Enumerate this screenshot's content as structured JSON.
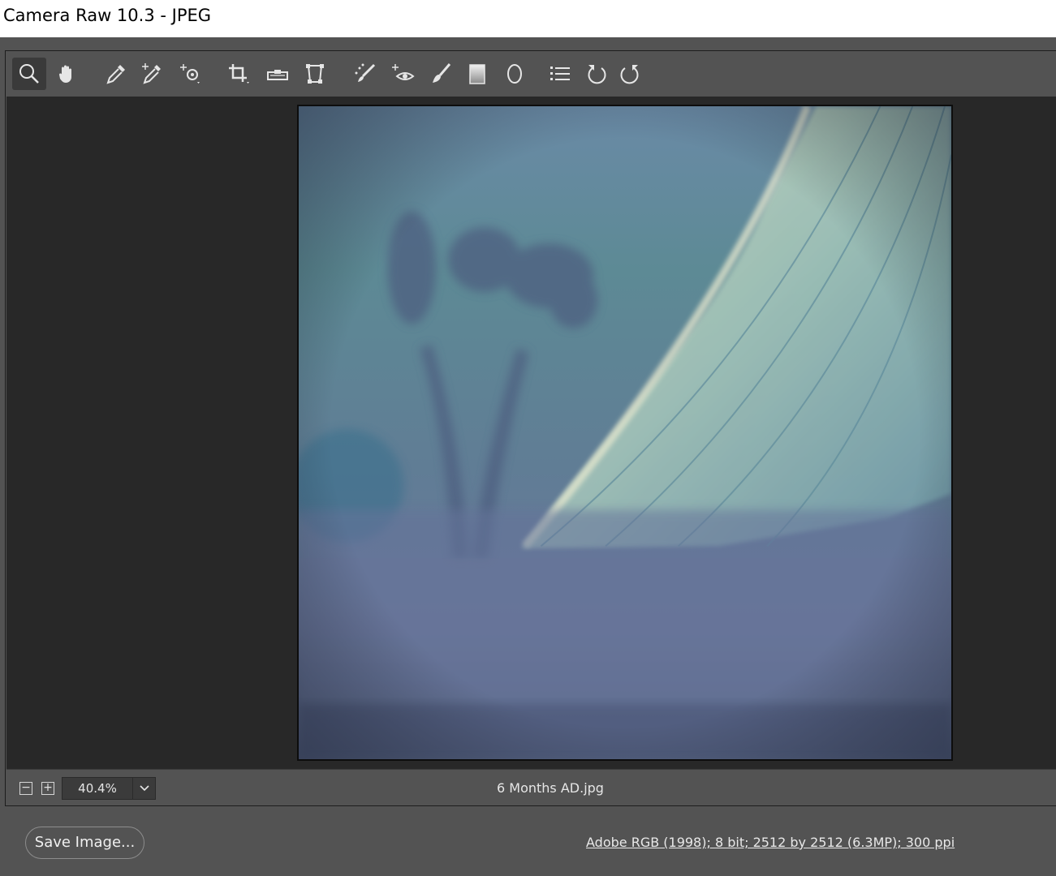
{
  "window": {
    "title": "Camera Raw 10.3  -  JPEG"
  },
  "toolbar": {
    "tools": [
      {
        "name": "zoom-tool",
        "icon": "magnifier-icon",
        "active": true
      },
      {
        "name": "hand-tool",
        "icon": "hand-icon"
      },
      {
        "name": "white-balance-tool",
        "icon": "eyedropper-icon"
      },
      {
        "name": "color-sampler-tool",
        "icon": "color-sampler-icon"
      },
      {
        "name": "targeted-adjustment-tool",
        "icon": "target-adjust-icon"
      },
      {
        "name": "crop-tool",
        "icon": "crop-icon"
      },
      {
        "name": "straighten-tool",
        "icon": "level-icon"
      },
      {
        "name": "transform-tool",
        "icon": "transform-icon"
      },
      {
        "name": "spot-removal-tool",
        "icon": "spot-removal-icon"
      },
      {
        "name": "red-eye-removal-tool",
        "icon": "red-eye-icon"
      },
      {
        "name": "adjustment-brush-tool",
        "icon": "brush-icon"
      },
      {
        "name": "graduated-filter-tool",
        "icon": "gradient-icon"
      },
      {
        "name": "radial-filter-tool",
        "icon": "ellipse-icon"
      },
      {
        "name": "preferences-button",
        "icon": "list-icon"
      },
      {
        "name": "rotate-left-button",
        "icon": "rotate-ccw-icon"
      },
      {
        "name": "rotate-right-button",
        "icon": "rotate-cw-icon"
      }
    ]
  },
  "preview": {
    "filename": "6 Months AD.jpg"
  },
  "zoom": {
    "minus_label": "−",
    "plus_label": "+",
    "value": "40.4%"
  },
  "footer": {
    "save_label": "Save Image...",
    "workflow_options": "Adobe RGB (1998); 8 bit; 2512 by 2512 (6.3MP); 300 ppi"
  },
  "colors": {
    "panel": "#535353",
    "canvas": "#282828",
    "photo_sky": "#5d7f96",
    "photo_trail": "#b9d1bf"
  }
}
